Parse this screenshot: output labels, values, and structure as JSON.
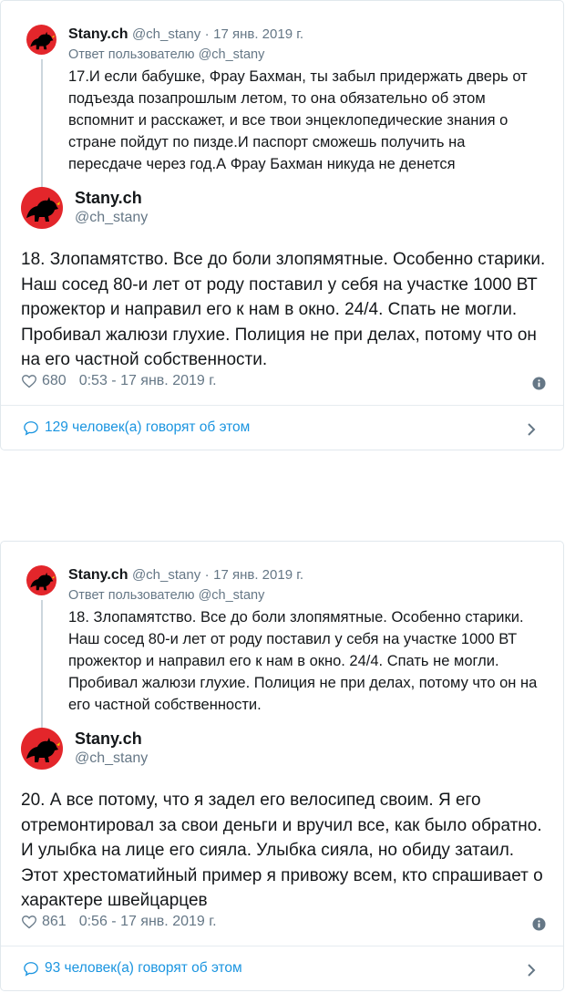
{
  "tweets": [
    {
      "quoted": {
        "name": "Stany.ch",
        "handle": "@ch_stany",
        "dot": "·",
        "date": "17 янв. 2019 г.",
        "reply_to": "Ответ пользователю @ch_stany",
        "text": "17.И если бабушке, Фрау Бахман, ты забыл придержать дверь от подъезда позапрошлым летом, то она обязательно об этом вспомнит и расскажет, и все твои энцеклопедические знания о стране пойдут по пизде.И паспорт сможешь получить на пересдаче через год.А Фрау Бахман никуда не денется"
      },
      "name": "Stany.ch",
      "handle": "@ch_stany",
      "text": "18. Злопамятство. Все до боли злопямятные. Особенно старики. Наш сосед 80-и лет от роду поставил у себя на участке 1000 ВТ прожектор и направил его к нам в окно. 24/4. Спать не могли. Пробивал жалюзи глухие.  Полиция не при делах, потому что он на его частной собственности.",
      "likes": "680",
      "timestamp": "0:53 - 17 янв. 2019 г.",
      "discussion": "129 человек(а) говорят об этом"
    },
    {
      "quoted": {
        "name": "Stany.ch",
        "handle": "@ch_stany",
        "dot": "·",
        "date": "17 янв. 2019 г.",
        "reply_to": "Ответ пользователю @ch_stany",
        "text": "18. Злопамятство. Все до боли злопямятные. Особенно старики. Наш сосед 80-и лет от роду поставил у себя на участке 1000 ВТ прожектор и направил его к нам в окно. 24/4. Спать не могли. Пробивал жалюзи глухие.  Полиция не при делах, потому что он на его частной собственности."
      },
      "name": "Stany.ch",
      "handle": "@ch_stany",
      "text": "20. А все потому, что я задел его велосипед своим. Я его отремонтировал за свои деньги и вручил все, как было обратно. И улыбка на лице его сияла. Улыбка сияла, но обиду затаил. Этот хрестоматийный  пример я привожу всем, кто спрашивает о характере швейцарцев",
      "likes": "861",
      "timestamp": "0:56 - 17 янв. 2019 г.",
      "discussion": "93 человек(а) говорят об этом"
    }
  ],
  "colors": {
    "link": "#1b95e0",
    "muted": "#657786",
    "border": "#e1e8ed",
    "avatar_bg": "#e3262b",
    "bear": "#000000",
    "bear_accent": "#f7c300"
  }
}
